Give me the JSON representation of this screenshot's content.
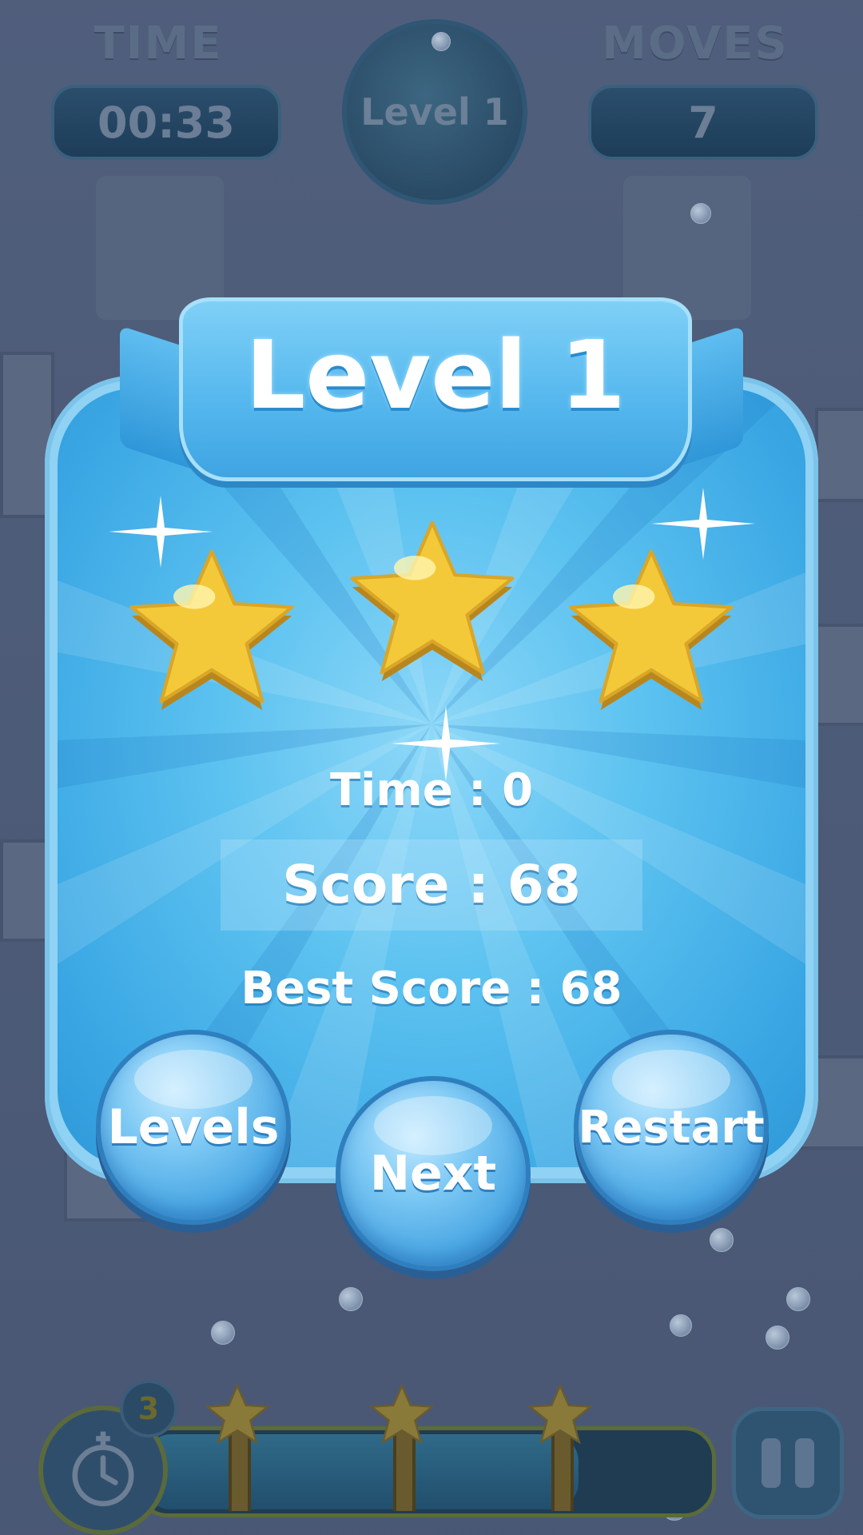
{
  "hud": {
    "time_label": "TIME",
    "time_value": "00:33",
    "moves_label": "MOVES",
    "moves_value": "7",
    "level_badge": "Level 1"
  },
  "result": {
    "title": "Level 1",
    "stars_earned": 3,
    "time_text": "Time : 0",
    "score_text": "Score : 68",
    "best_score_text": "Best Score : 68"
  },
  "buttons": {
    "levels": "Levels",
    "next": "Next",
    "restart": "Restart"
  },
  "bottom_bar": {
    "hint_count": "3",
    "progress_fraction": 0.77,
    "star_markers": 3
  },
  "colors": {
    "panel": "#3aa7e4",
    "star_gold": "#f3c93a",
    "background": "#4a5a78"
  }
}
